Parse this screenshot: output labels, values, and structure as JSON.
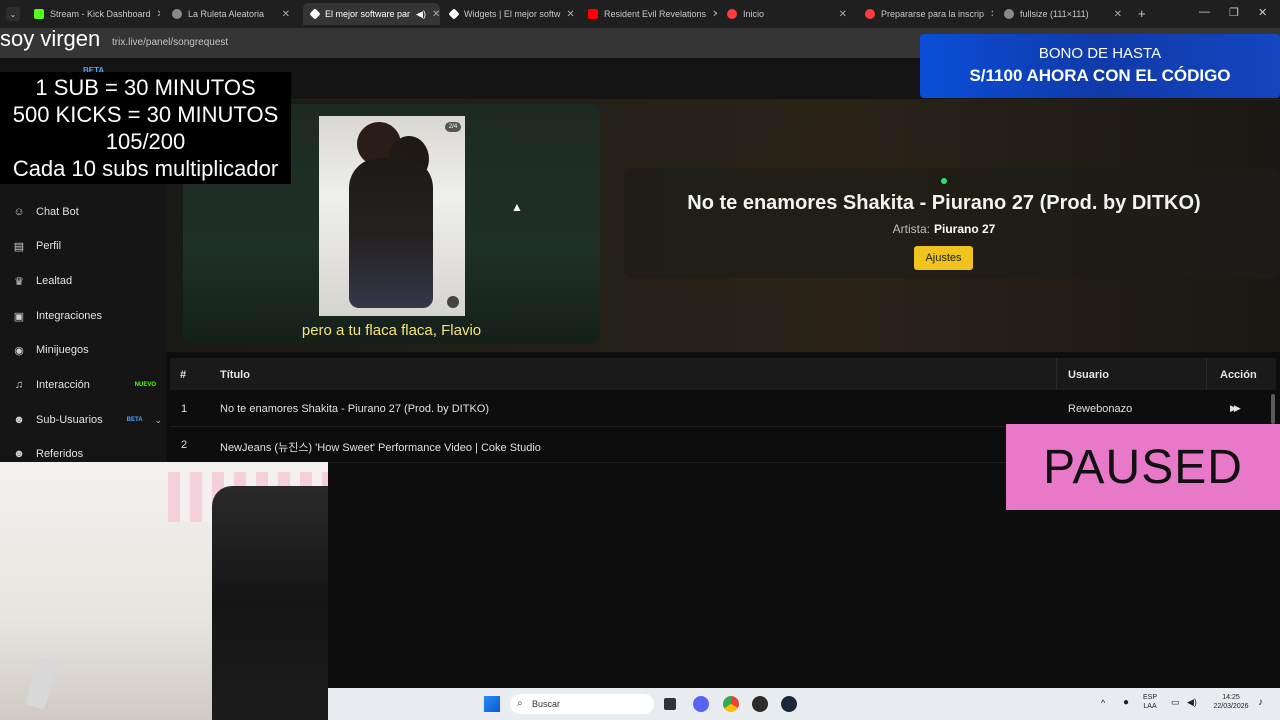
{
  "browser": {
    "tabs": [
      {
        "label": "Stream - Kick Dashboard",
        "icon": "kick-icon",
        "color": "#53fc18"
      },
      {
        "label": "La Ruleta Aleatoria",
        "icon": "globe-icon",
        "color": "#8a8a8a"
      },
      {
        "label": "El mejor software par",
        "icon": "diamond-icon",
        "color": "#ffffff"
      },
      {
        "label": "Widgets | El mejor softw",
        "icon": "diamond-icon",
        "color": "#ffffff"
      },
      {
        "label": "Resident Evil Revelations",
        "icon": "youtube-icon",
        "color": "#ff0000"
      },
      {
        "label": "Inicio",
        "icon": "brand-icon",
        "color": "#ff3b3b"
      },
      {
        "label": "Prepararse para la inscrip",
        "icon": "brand-icon",
        "color": "#ff3b3b"
      },
      {
        "label": "fullsize (111×111)",
        "icon": "globe-icon",
        "color": "#8a8a8a"
      }
    ],
    "url": "trix.live/panel/songrequest"
  },
  "overlay": {
    "soy": "soy virgen",
    "line1": "1 SUB     = 30 MINUTOS",
    "line2": "500 KICKS = 30 MINUTOS",
    "line3": "105/200",
    "line4": "Cada 10 subs multiplicador",
    "beta": "BETA"
  },
  "banner": {
    "line1": "BONO DE HASTA",
    "line2": "S/1100 AHORA CON EL CÓDIGO"
  },
  "sidebar": {
    "items": [
      {
        "label": "Chat Bot",
        "icon": "robot-icon",
        "glyph": "☺",
        "badge": ""
      },
      {
        "label": "Perfil",
        "icon": "profile-card-icon",
        "glyph": "▤",
        "badge": ""
      },
      {
        "label": "Lealtad",
        "icon": "trophy-icon",
        "glyph": "♛",
        "badge": ""
      },
      {
        "label": "Integraciones",
        "icon": "integrations-icon",
        "glyph": "▣",
        "badge": ""
      },
      {
        "label": "Minijuegos",
        "icon": "gamepad-icon",
        "glyph": "◉",
        "badge": ""
      },
      {
        "label": "Interacción",
        "icon": "music-icon",
        "glyph": "♫",
        "badge": "NUEVO"
      },
      {
        "label": "Sub-Usuarios",
        "icon": "users-icon",
        "glyph": "☻",
        "badge": "BETA"
      },
      {
        "label": "Referidos",
        "icon": "users-icon",
        "glyph": "☻",
        "badge": ""
      }
    ]
  },
  "player": {
    "counter": "2/4",
    "subtitle": "pero a tu flaca flaca, Flavio"
  },
  "now_playing": {
    "title": "No te enamores Shakita - Piurano 27 (Prod. by DITKO)",
    "artist_label": "Artista:",
    "artist": "Piurano 27",
    "settings_button": "Ajustes"
  },
  "table": {
    "headers": {
      "num": "#",
      "title": "Título",
      "user": "Usuario",
      "action": "Acción"
    },
    "rows": [
      {
        "num": "1",
        "title": "No te enamores Shakita - Piurano 27 (Prod. by DITKO)",
        "user": "Rewebonazo",
        "action": "▶▶"
      },
      {
        "num": "2",
        "title": "NewJeans (뉴진스) 'How Sweet' Performance Video | Coke Studio",
        "user": "",
        "action": ""
      }
    ]
  },
  "paused": "PAUSED",
  "taskbar": {
    "search": "Buscar",
    "lang1": "ESP",
    "lang2": "LAA",
    "time": "14:25",
    "date": "22/03/2026"
  }
}
